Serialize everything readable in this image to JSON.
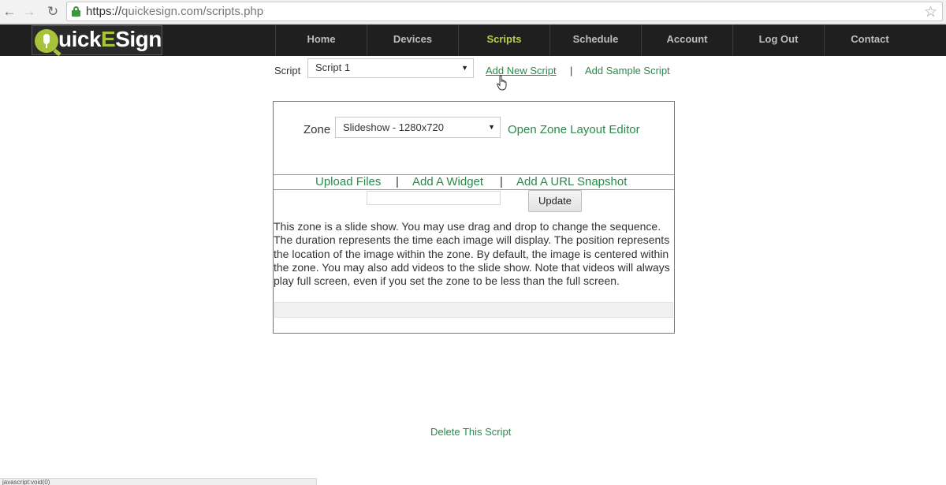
{
  "browser": {
    "url_scheme": "https://",
    "url_rest": "quickesign.com/scripts.php"
  },
  "logo": {
    "prefix": "uick",
    "accent": "E",
    "suffix": "Sign"
  },
  "nav": {
    "items": [
      "Home",
      "Devices",
      "Scripts",
      "Schedule",
      "Account",
      "Log Out",
      "Contact"
    ],
    "active": "Scripts"
  },
  "script": {
    "label": "Script",
    "selected": "Script 1",
    "add_new_label": "Add New Script",
    "separator": "|",
    "add_sample_label": "Add Sample Script"
  },
  "zone": {
    "label": "Zone",
    "selected": "Slideshow - 1280x720",
    "editor_link": "Open Zone Layout Editor",
    "actions": [
      "Upload Files",
      "Add A Widget",
      "Add A URL Snapshot"
    ],
    "update_label": "Update",
    "description": "This zone is a slide show. You may use drag and drop to change the sequence. The duration represents the time each image will display. The position represents the location of the image within the zone. By default, the image is centered within the zone. You may also add videos to the slide show. Note that videos will always play full screen, even if you set the zone to be less than the full screen."
  },
  "delete_label": "Delete This Script",
  "status_text": "javascript:void(0)",
  "colors": {
    "link": "#2a8a4a",
    "nav_bg": "#1f1f1f",
    "nav_active": "#b6d23e",
    "logo_accent": "#a8c33a"
  }
}
